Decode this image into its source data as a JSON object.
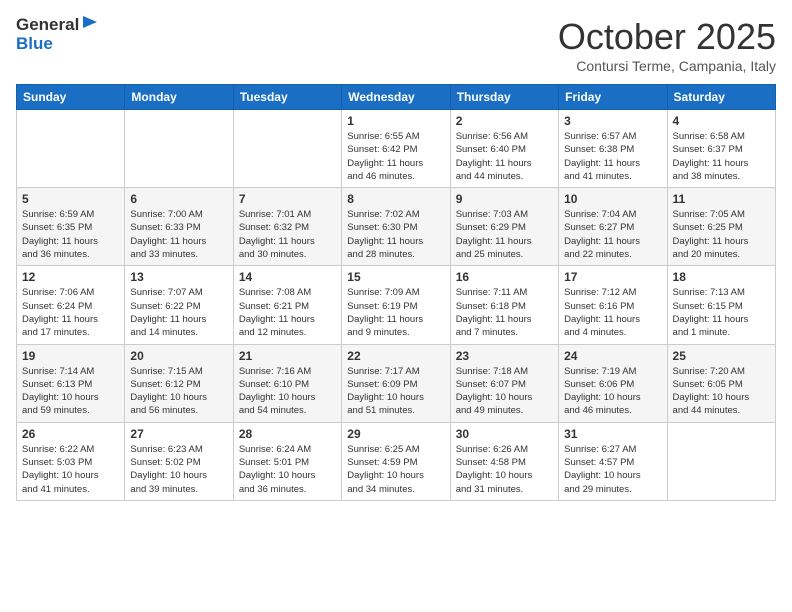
{
  "header": {
    "logo_general": "General",
    "logo_blue": "Blue",
    "month_title": "October 2025",
    "location": "Contursi Terme, Campania, Italy"
  },
  "days_of_week": [
    "Sunday",
    "Monday",
    "Tuesday",
    "Wednesday",
    "Thursday",
    "Friday",
    "Saturday"
  ],
  "weeks": [
    [
      {
        "day": "",
        "info": ""
      },
      {
        "day": "",
        "info": ""
      },
      {
        "day": "",
        "info": ""
      },
      {
        "day": "1",
        "info": "Sunrise: 6:55 AM\nSunset: 6:42 PM\nDaylight: 11 hours\nand 46 minutes."
      },
      {
        "day": "2",
        "info": "Sunrise: 6:56 AM\nSunset: 6:40 PM\nDaylight: 11 hours\nand 44 minutes."
      },
      {
        "day": "3",
        "info": "Sunrise: 6:57 AM\nSunset: 6:38 PM\nDaylight: 11 hours\nand 41 minutes."
      },
      {
        "day": "4",
        "info": "Sunrise: 6:58 AM\nSunset: 6:37 PM\nDaylight: 11 hours\nand 38 minutes."
      }
    ],
    [
      {
        "day": "5",
        "info": "Sunrise: 6:59 AM\nSunset: 6:35 PM\nDaylight: 11 hours\nand 36 minutes."
      },
      {
        "day": "6",
        "info": "Sunrise: 7:00 AM\nSunset: 6:33 PM\nDaylight: 11 hours\nand 33 minutes."
      },
      {
        "day": "7",
        "info": "Sunrise: 7:01 AM\nSunset: 6:32 PM\nDaylight: 11 hours\nand 30 minutes."
      },
      {
        "day": "8",
        "info": "Sunrise: 7:02 AM\nSunset: 6:30 PM\nDaylight: 11 hours\nand 28 minutes."
      },
      {
        "day": "9",
        "info": "Sunrise: 7:03 AM\nSunset: 6:29 PM\nDaylight: 11 hours\nand 25 minutes."
      },
      {
        "day": "10",
        "info": "Sunrise: 7:04 AM\nSunset: 6:27 PM\nDaylight: 11 hours\nand 22 minutes."
      },
      {
        "day": "11",
        "info": "Sunrise: 7:05 AM\nSunset: 6:25 PM\nDaylight: 11 hours\nand 20 minutes."
      }
    ],
    [
      {
        "day": "12",
        "info": "Sunrise: 7:06 AM\nSunset: 6:24 PM\nDaylight: 11 hours\nand 17 minutes."
      },
      {
        "day": "13",
        "info": "Sunrise: 7:07 AM\nSunset: 6:22 PM\nDaylight: 11 hours\nand 14 minutes."
      },
      {
        "day": "14",
        "info": "Sunrise: 7:08 AM\nSunset: 6:21 PM\nDaylight: 11 hours\nand 12 minutes."
      },
      {
        "day": "15",
        "info": "Sunrise: 7:09 AM\nSunset: 6:19 PM\nDaylight: 11 hours\nand 9 minutes."
      },
      {
        "day": "16",
        "info": "Sunrise: 7:11 AM\nSunset: 6:18 PM\nDaylight: 11 hours\nand 7 minutes."
      },
      {
        "day": "17",
        "info": "Sunrise: 7:12 AM\nSunset: 6:16 PM\nDaylight: 11 hours\nand 4 minutes."
      },
      {
        "day": "18",
        "info": "Sunrise: 7:13 AM\nSunset: 6:15 PM\nDaylight: 11 hours\nand 1 minute."
      }
    ],
    [
      {
        "day": "19",
        "info": "Sunrise: 7:14 AM\nSunset: 6:13 PM\nDaylight: 10 hours\nand 59 minutes."
      },
      {
        "day": "20",
        "info": "Sunrise: 7:15 AM\nSunset: 6:12 PM\nDaylight: 10 hours\nand 56 minutes."
      },
      {
        "day": "21",
        "info": "Sunrise: 7:16 AM\nSunset: 6:10 PM\nDaylight: 10 hours\nand 54 minutes."
      },
      {
        "day": "22",
        "info": "Sunrise: 7:17 AM\nSunset: 6:09 PM\nDaylight: 10 hours\nand 51 minutes."
      },
      {
        "day": "23",
        "info": "Sunrise: 7:18 AM\nSunset: 6:07 PM\nDaylight: 10 hours\nand 49 minutes."
      },
      {
        "day": "24",
        "info": "Sunrise: 7:19 AM\nSunset: 6:06 PM\nDaylight: 10 hours\nand 46 minutes."
      },
      {
        "day": "25",
        "info": "Sunrise: 7:20 AM\nSunset: 6:05 PM\nDaylight: 10 hours\nand 44 minutes."
      }
    ],
    [
      {
        "day": "26",
        "info": "Sunrise: 6:22 AM\nSunset: 5:03 PM\nDaylight: 10 hours\nand 41 minutes."
      },
      {
        "day": "27",
        "info": "Sunrise: 6:23 AM\nSunset: 5:02 PM\nDaylight: 10 hours\nand 39 minutes."
      },
      {
        "day": "28",
        "info": "Sunrise: 6:24 AM\nSunset: 5:01 PM\nDaylight: 10 hours\nand 36 minutes."
      },
      {
        "day": "29",
        "info": "Sunrise: 6:25 AM\nSunset: 4:59 PM\nDaylight: 10 hours\nand 34 minutes."
      },
      {
        "day": "30",
        "info": "Sunrise: 6:26 AM\nSunset: 4:58 PM\nDaylight: 10 hours\nand 31 minutes."
      },
      {
        "day": "31",
        "info": "Sunrise: 6:27 AM\nSunset: 4:57 PM\nDaylight: 10 hours\nand 29 minutes."
      },
      {
        "day": "",
        "info": ""
      }
    ]
  ]
}
